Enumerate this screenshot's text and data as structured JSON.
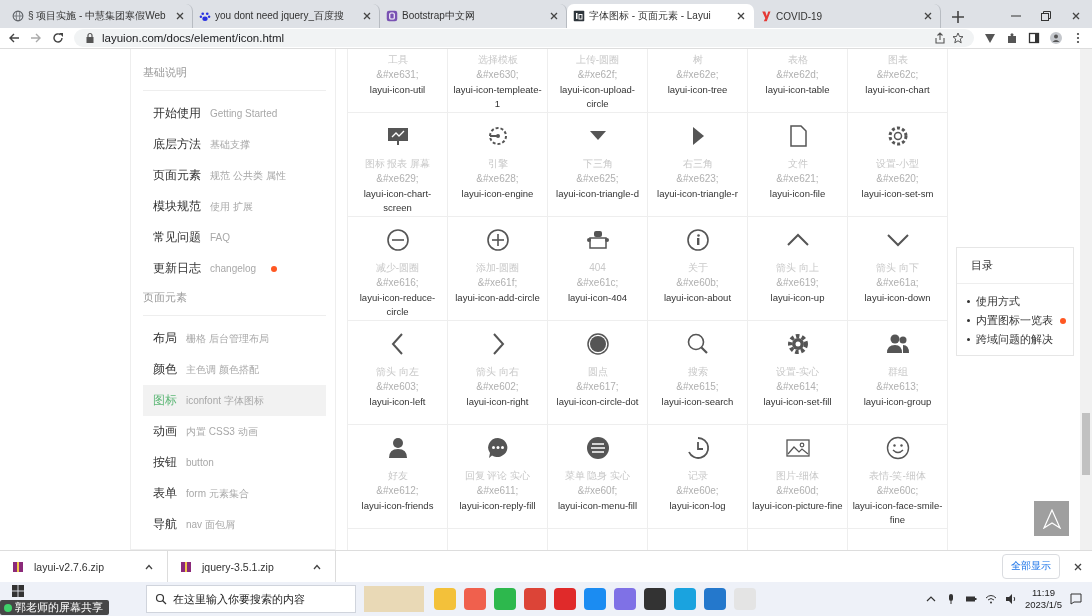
{
  "browser": {
    "tabs": [
      {
        "title": "§ 项目实施 - 中慧集团寒假Web",
        "selected": false
      },
      {
        "title": "you dont need jquery_百度搜",
        "selected": false
      },
      {
        "title": "Bootstrap中文网",
        "selected": false
      },
      {
        "title": "字体图标 - 页面元素 - Layui",
        "selected": true
      },
      {
        "title": "COVID-19",
        "selected": false
      }
    ],
    "address": "layuion.com/docs/element/icon.html"
  },
  "sidebar": {
    "groups": [
      {
        "heading": "基础说明",
        "items": [
          {
            "label": "开始使用",
            "sub": "Getting Started",
            "selected": false,
            "new": false
          },
          {
            "label": "底层方法",
            "sub": "基础支撑",
            "selected": false,
            "new": false
          },
          {
            "label": "页面元素",
            "sub": "规范 公共类 属性",
            "selected": false,
            "new": false
          },
          {
            "label": "模块规范",
            "sub": "使用 扩展",
            "selected": false,
            "new": false
          },
          {
            "label": "常见问题",
            "sub": "FAQ",
            "selected": false,
            "new": false
          },
          {
            "label": "更新日志",
            "sub": "changelog",
            "selected": false,
            "new": true
          }
        ]
      },
      {
        "heading": "页面元素",
        "items": [
          {
            "label": "布局",
            "sub": "栅格 后台管理布局",
            "selected": false,
            "new": false
          },
          {
            "label": "颜色",
            "sub": "主色调 颜色搭配",
            "selected": false,
            "new": false
          },
          {
            "label": "图标",
            "sub": "iconfont 字体图标",
            "selected": true,
            "new": false
          },
          {
            "label": "动画",
            "sub": "内置 CSS3 动画",
            "selected": false,
            "new": false
          },
          {
            "label": "按钮",
            "sub": "button",
            "selected": false,
            "new": false
          },
          {
            "label": "表单",
            "sub": "form 元素集合",
            "selected": false,
            "new": false
          },
          {
            "label": "导航",
            "sub": "nav 面包屑",
            "selected": false,
            "new": false
          }
        ]
      }
    ]
  },
  "icons": [
    {
      "name": "工具",
      "code": "&#xe631;",
      "class": "layui-icon-util"
    },
    {
      "name": "选择模板",
      "code": "&#xe630;",
      "class": "layui-icon-templeate-1"
    },
    {
      "name": "上传-圆圈",
      "code": "&#xe62f;",
      "class": "layui-icon-upload-circle"
    },
    {
      "name": "树",
      "code": "&#xe62e;",
      "class": "layui-icon-tree"
    },
    {
      "name": "表格",
      "code": "&#xe62d;",
      "class": "layui-icon-table"
    },
    {
      "name": "图表",
      "code": "&#xe62c;",
      "class": "layui-icon-chart"
    },
    {
      "name": "图标 报表 屏幕",
      "code": "&#xe629;",
      "class": "layui-icon-chart-screen"
    },
    {
      "name": "引擎",
      "code": "&#xe628;",
      "class": "layui-icon-engine"
    },
    {
      "name": "下三角",
      "code": "&#xe625;",
      "class": "layui-icon-triangle-d"
    },
    {
      "name": "右三角",
      "code": "&#xe623;",
      "class": "layui-icon-triangle-r"
    },
    {
      "name": "文件",
      "code": "&#xe621;",
      "class": "layui-icon-file"
    },
    {
      "name": "设置-小型",
      "code": "&#xe620;",
      "class": "layui-icon-set-sm"
    },
    {
      "name": "减少-圆圈",
      "code": "&#xe616;",
      "class": "layui-icon-reduce-circle"
    },
    {
      "name": "添加-圆圈",
      "code": "&#xe61f;",
      "class": "layui-icon-add-circle"
    },
    {
      "name": "404",
      "code": "&#xe61c;",
      "class": "layui-icon-404"
    },
    {
      "name": "关于",
      "code": "&#xe60b;",
      "class": "layui-icon-about"
    },
    {
      "name": "箭头 向上",
      "code": "&#xe619;",
      "class": "layui-icon-up"
    },
    {
      "name": "箭头 向下",
      "code": "&#xe61a;",
      "class": "layui-icon-down"
    },
    {
      "name": "箭头 向左",
      "code": "&#xe603;",
      "class": "layui-icon-left"
    },
    {
      "name": "箭头 向右",
      "code": "&#xe602;",
      "class": "layui-icon-right"
    },
    {
      "name": "圆点",
      "code": "&#xe617;",
      "class": "layui-icon-circle-dot"
    },
    {
      "name": "搜索",
      "code": "&#xe615;",
      "class": "layui-icon-search"
    },
    {
      "name": "设置-实心",
      "code": "&#xe614;",
      "class": "layui-icon-set-fill"
    },
    {
      "name": "群组",
      "code": "&#xe613;",
      "class": "layui-icon-group"
    },
    {
      "name": "好友",
      "code": "&#xe612;",
      "class": "layui-icon-friends"
    },
    {
      "name": "回复 评论 实心",
      "code": "&#xe611;",
      "class": "layui-icon-reply-fill"
    },
    {
      "name": "菜单 隐身 实心",
      "code": "&#xe60f;",
      "class": "layui-icon-menu-fill"
    },
    {
      "name": "记录",
      "code": "&#xe60e;",
      "class": "layui-icon-log"
    },
    {
      "name": "图片-细体",
      "code": "&#xe60d;",
      "class": "layui-icon-picture-fine"
    },
    {
      "name": "表情-笑-细体",
      "code": "&#xe60c;",
      "class": "layui-icon-face-smile-fine"
    }
  ],
  "toc": {
    "title": "目录",
    "items": [
      {
        "label": "使用方式",
        "new": false
      },
      {
        "label": "内置图标一览表",
        "new": true
      },
      {
        "label": "跨域问题的解决",
        "new": false
      }
    ]
  },
  "downloads": {
    "files": [
      "layui-v2.7.6.zip",
      "jquery-3.5.1.zip"
    ],
    "show_all": "全部显示"
  },
  "taskbar": {
    "search_placeholder": "在这里输入你要搜索的内容",
    "share_badge": "郭老师的屏幕共享",
    "time": "11:19",
    "date": "2023/1/5"
  }
}
